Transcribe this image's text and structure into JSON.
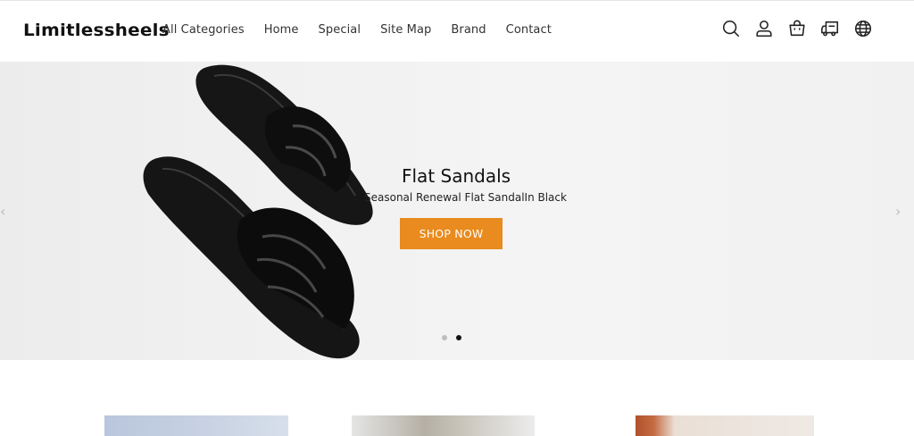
{
  "brand": {
    "logo_text": "Limitlessheels"
  },
  "nav": {
    "items": [
      "All Categories",
      "Home",
      "Special",
      "Site Map",
      "Brand",
      "Contact"
    ]
  },
  "header_icons": [
    "search-icon",
    "account-icon",
    "cart-icon",
    "shipping-truck-icon",
    "language-globe-icon"
  ],
  "hero": {
    "title": "Flat Sandals",
    "subtitle": "Seasonal Renewal Flat SandalIn Black",
    "cta_label": "SHOP NOW",
    "cta_color": "#e98b1e",
    "slide_count": 2,
    "active_slide": 2,
    "prev_arrow": "‹",
    "next_arrow": "›"
  },
  "colors": {
    "accent": "#e98b1e",
    "text": "#222222",
    "hero_bg": "#f1f1f1"
  }
}
